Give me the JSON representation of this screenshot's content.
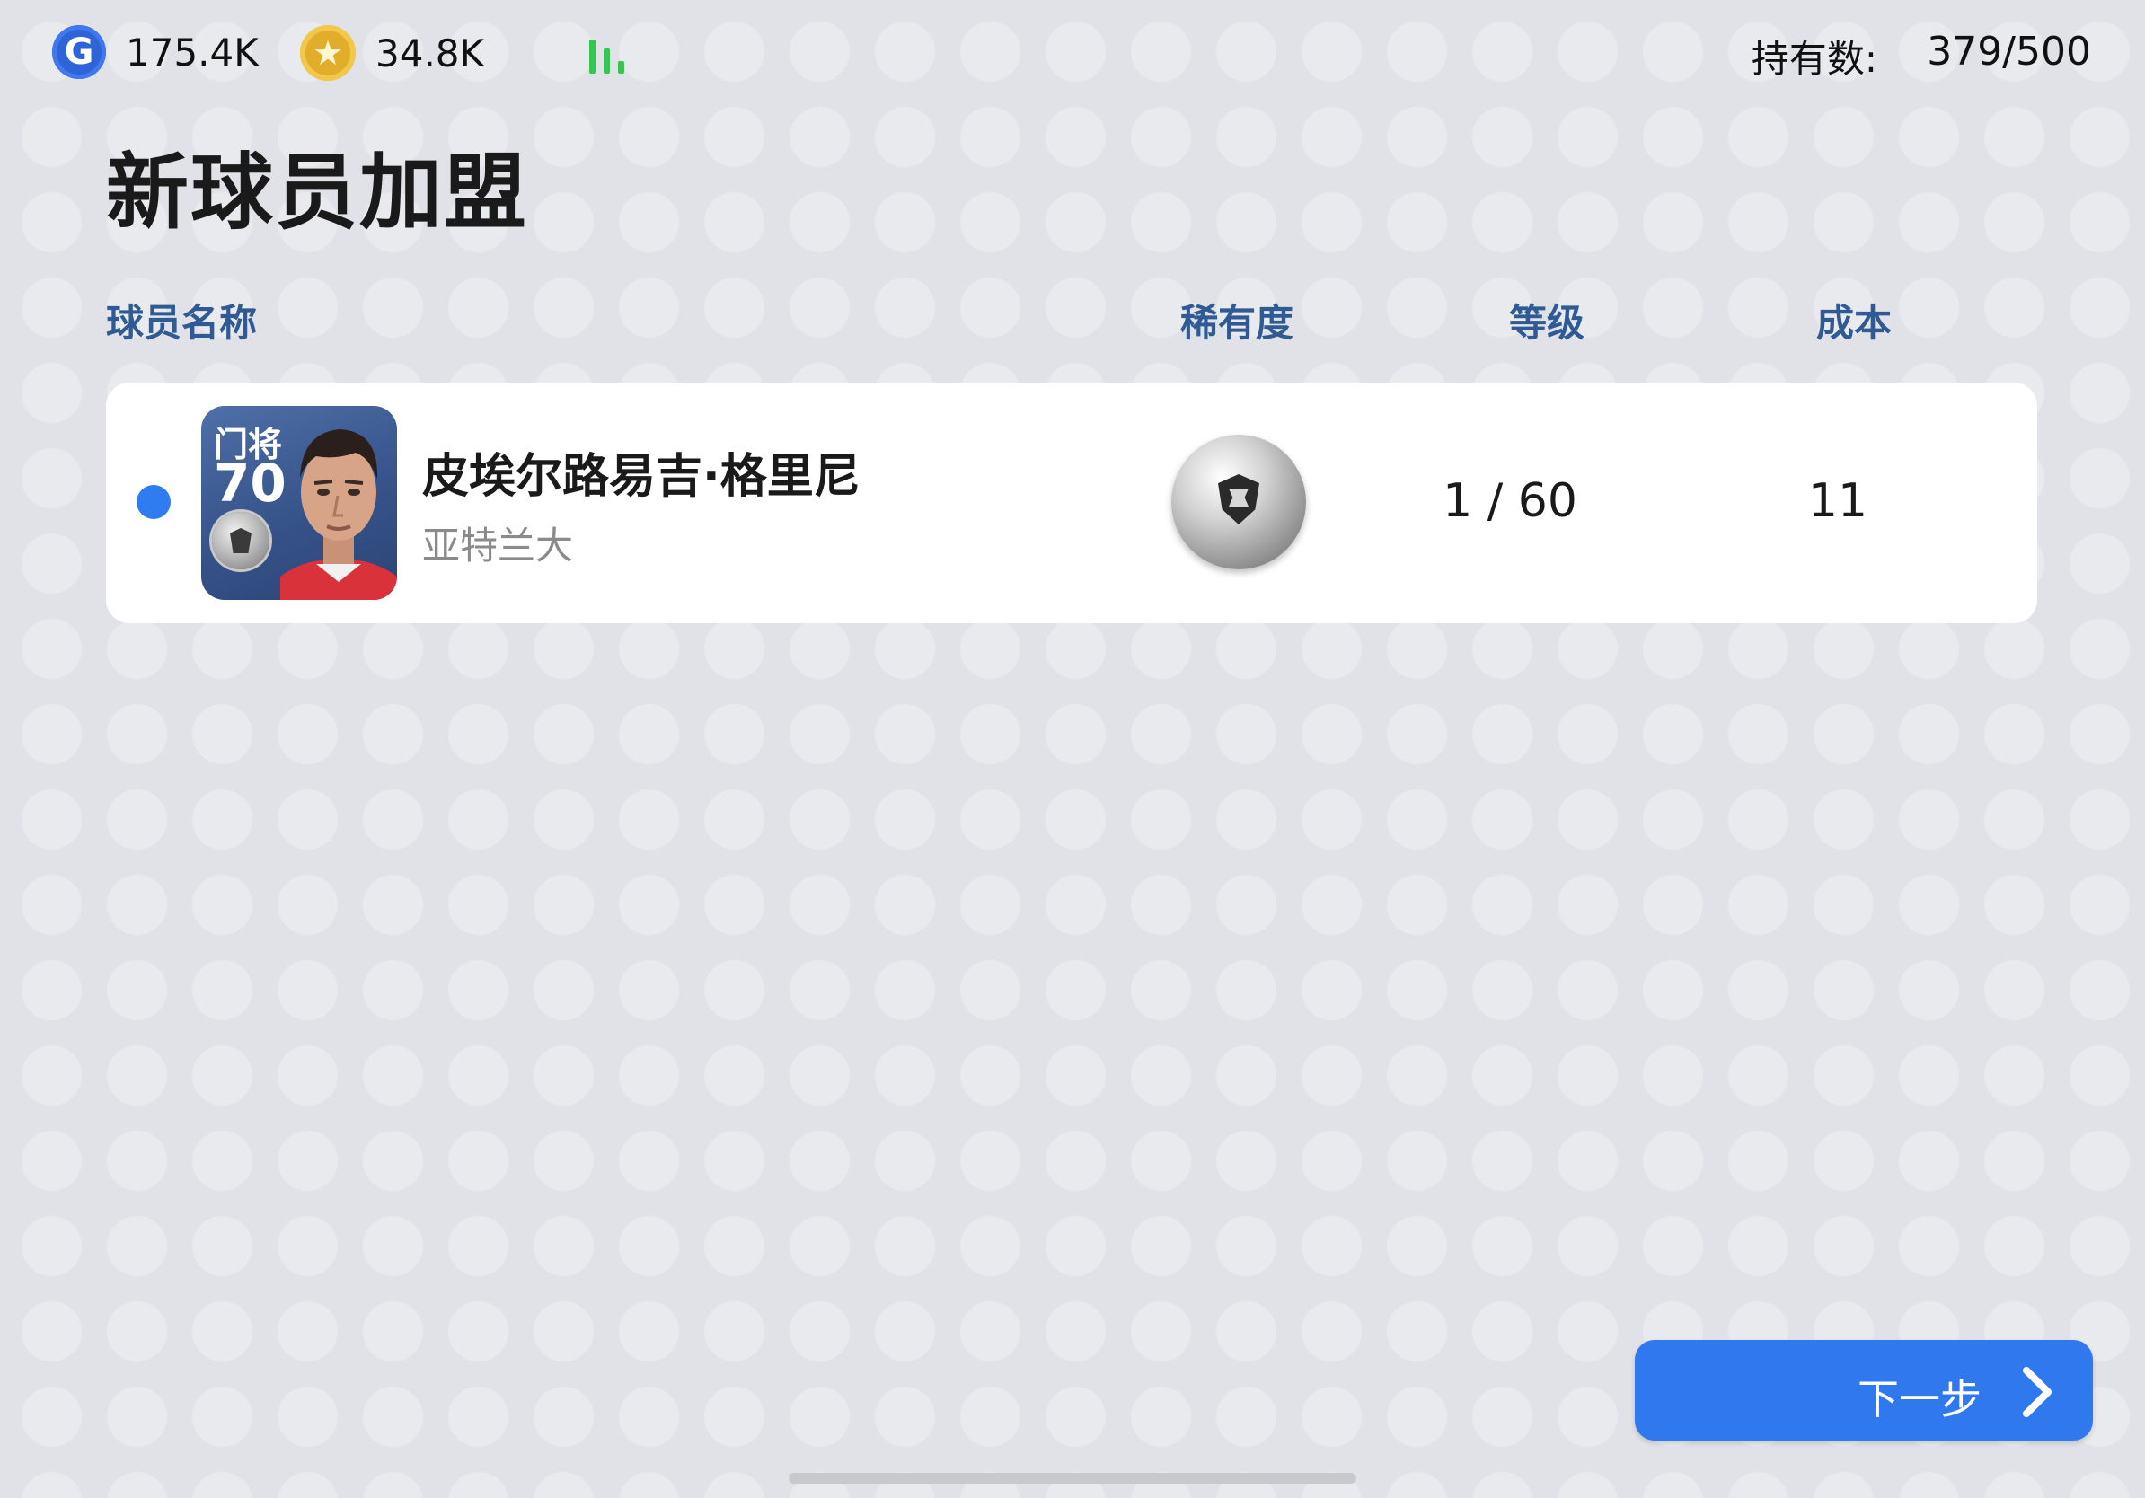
{
  "topbar": {
    "gp_icon": "G",
    "gp_value": "175.4K",
    "coin_icon": "★",
    "coin_value": "34.8K",
    "signal_icon": "connection-bars-icon",
    "holding_label": "持有数:",
    "holding_value": "379/500"
  },
  "title": "新球员加盟",
  "columns": {
    "name": "球员名称",
    "rarity": "稀有度",
    "level": "等级",
    "cost": "成本"
  },
  "players": [
    {
      "position": "门将",
      "rating": "70",
      "name": "皮埃尔路易吉·格里尼",
      "club": "亚特兰大",
      "rarity_icon": "silver-ball-icon",
      "level": "1 / 60",
      "cost": "11",
      "selected": true
    }
  ],
  "next_button": {
    "label": "下一步",
    "icon": "chevron-right-icon"
  },
  "colors": {
    "accent_blue": "#2f78ee",
    "header_text": "#2f5a94",
    "signal_green": "#36c552",
    "background": "#e1e2e7"
  }
}
